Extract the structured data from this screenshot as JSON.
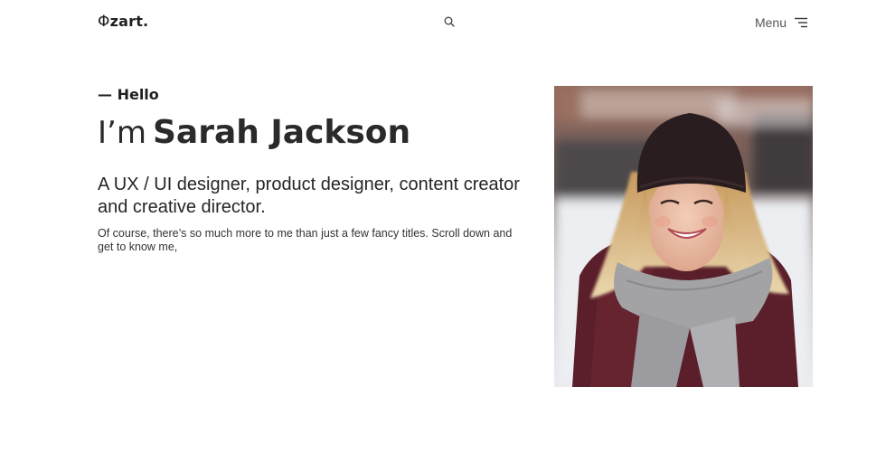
{
  "header": {
    "logo_glyph": "Φ",
    "logo_text": "zart",
    "logo_dot": ".",
    "search_icon": "search-icon",
    "menu_label": "Menu",
    "menu_icon": "hamburger-menu-icon"
  },
  "hero": {
    "hello": "— Hello",
    "intro_prefix": "I’m",
    "name": "Sarah Jackson",
    "tagline": "A UX / UI designer, product designer, content creator and creative director.",
    "description": "Of course, there’s so much more to me than just a few fancy titles. Scroll down and get to know me,"
  },
  "colors": {
    "text": "#2b2b2b",
    "muted": "#555555",
    "background": "#ffffff"
  }
}
